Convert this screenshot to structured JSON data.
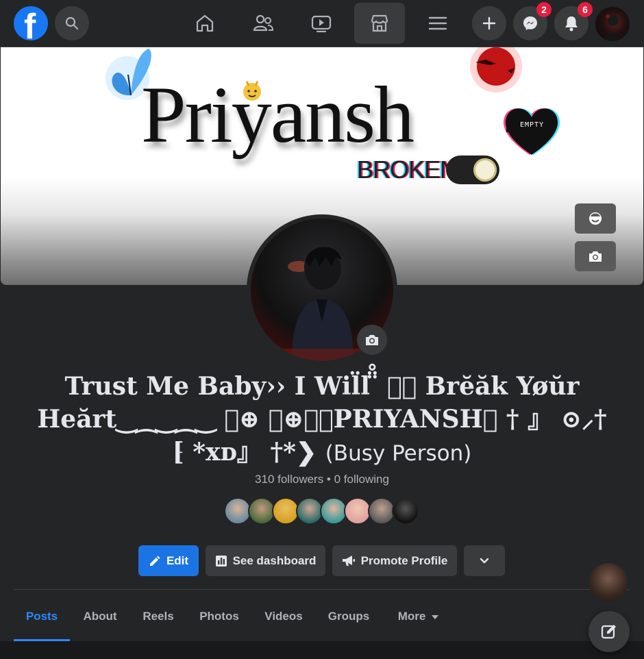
{
  "topbar": {
    "logo_letter": "f",
    "messenger_badge": "2",
    "notifications_badge": "6"
  },
  "cover": {
    "title": "Priyansh",
    "subtitle": "BROKEN",
    "heart_label": "EMPTY"
  },
  "profile": {
    "name": "Trust Me Baby›› I Will ̈̈̊ ⃝⃝ Break Yøur Heart‿‿‿ ⃝⊕ ⃝⊕⃝⃝PRIYANSH ⸸ ⸗ ⊙⸸ ⁅ *xᴅ ⸗ ⸸*❯",
    "name_line1": "Trust Me Baby›› I Wil̈l ̈̈̊ ⃝⃝ Brĕăk Yøŭr",
    "name_line2": "Heărt‿⁔‿⁔‿ ⃝⊕ ⃝⊕⃝⃝PRIYANSH⸝ † 』 ⊙⸝†",
    "name_line3": "⁅ *xᴅ』 †*❯",
    "nickname": "(Busy Person)",
    "followers_text": "310 followers • 0 following"
  },
  "actions": {
    "edit": "Edit",
    "dashboard": "See dashboard",
    "promote": "Promote Profile"
  },
  "tabs": [
    "Posts",
    "About",
    "Reels",
    "Photos",
    "Videos",
    "Groups",
    "More"
  ],
  "colors": {
    "accent": "#1b74e4",
    "tab_active": "#2d88ff",
    "badge": "#e41e3f",
    "background": "#242526"
  }
}
